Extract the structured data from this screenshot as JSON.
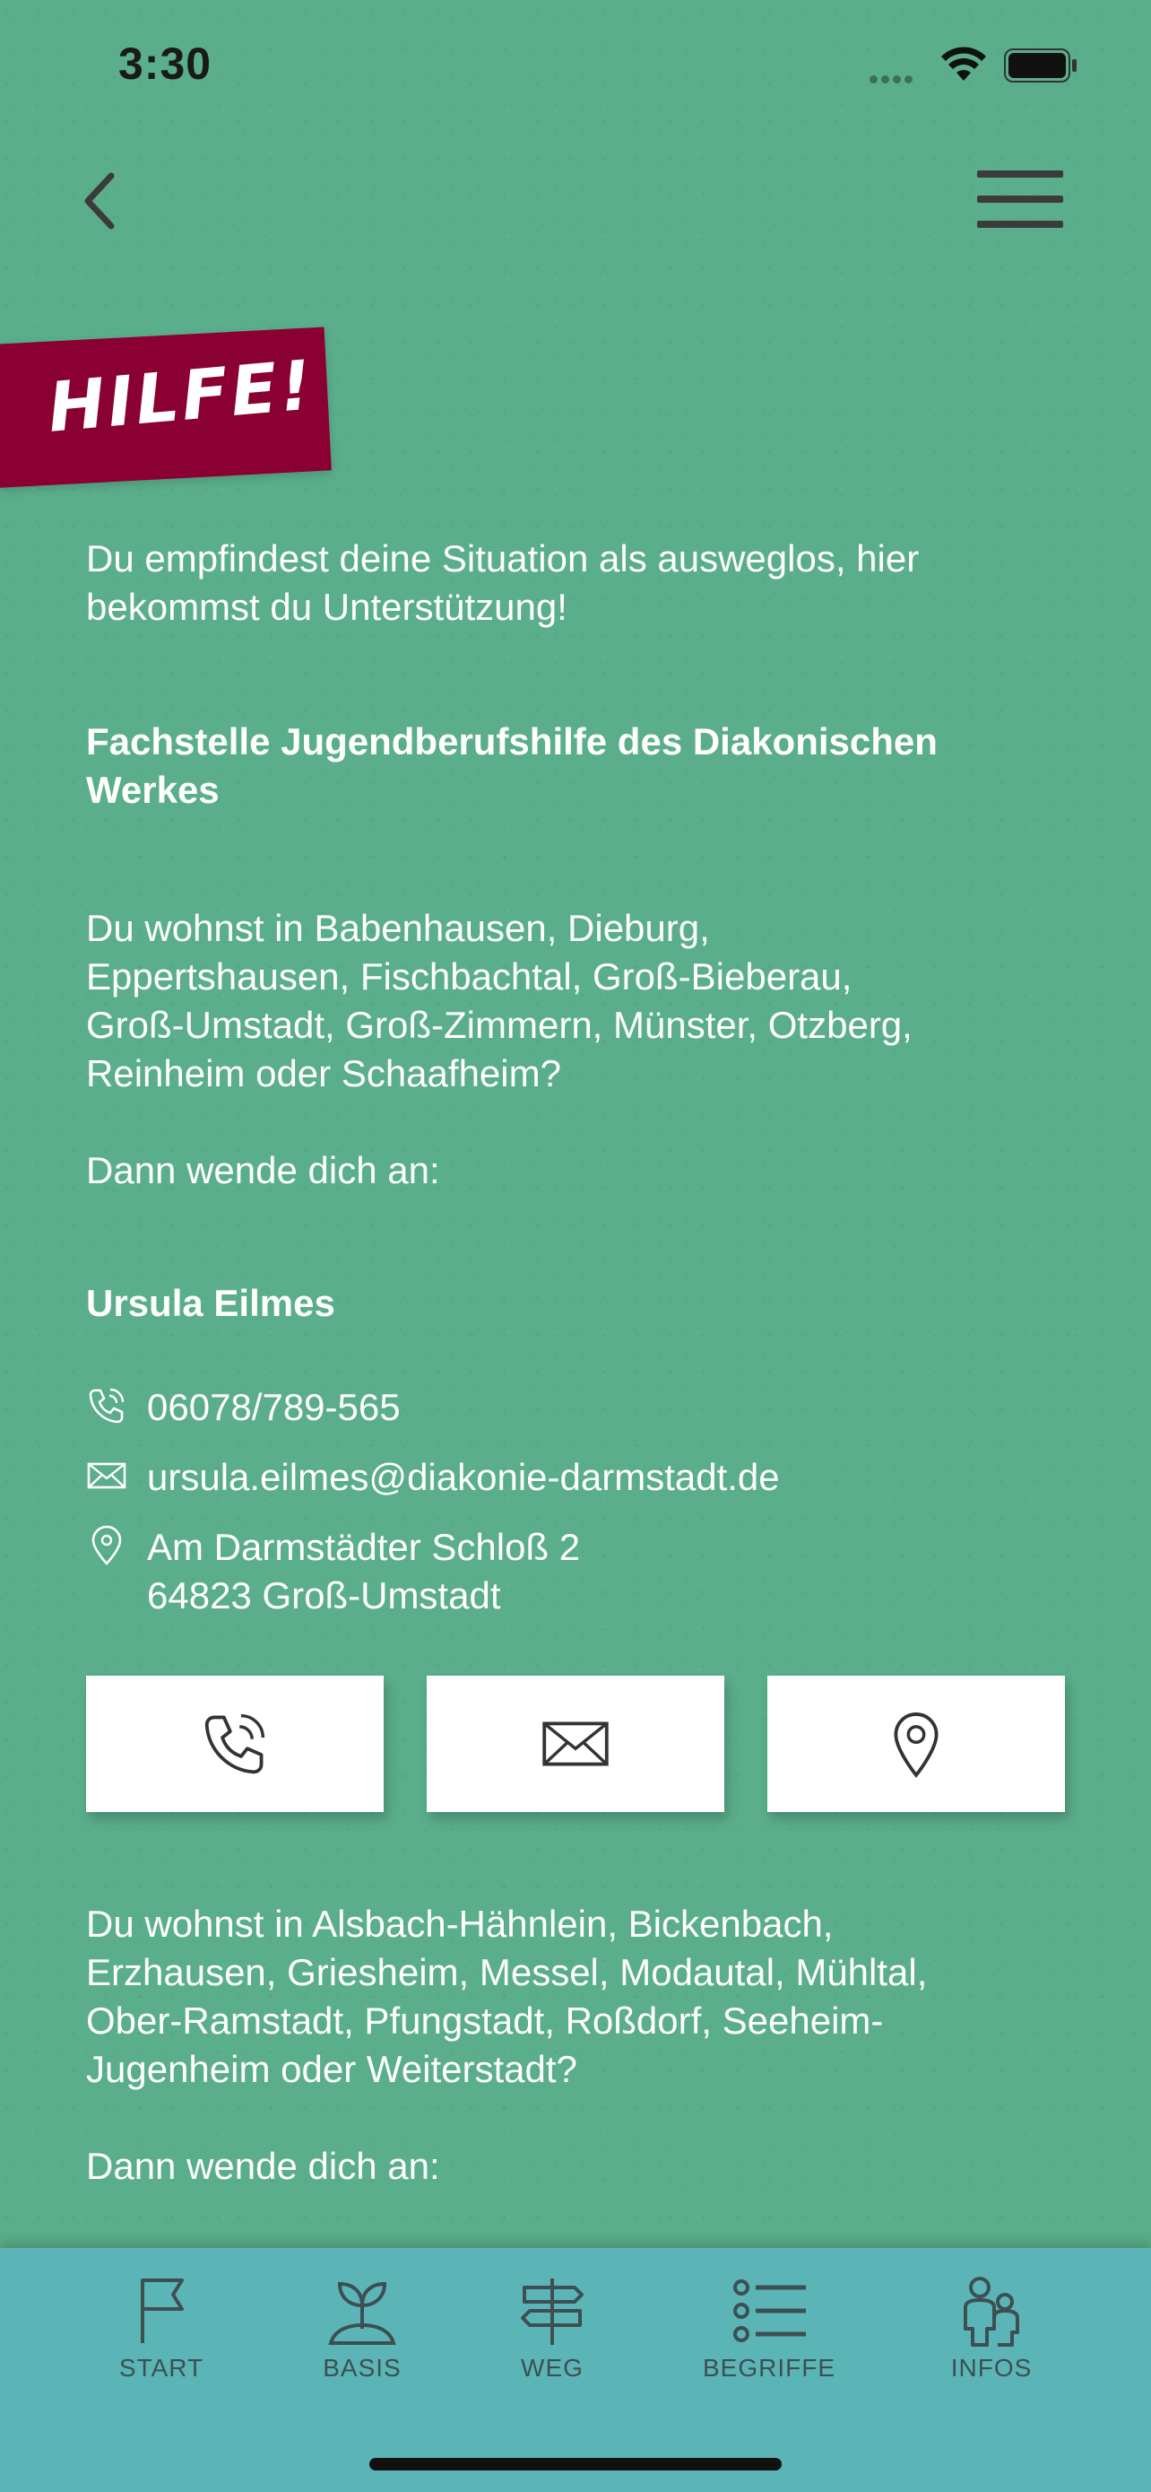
{
  "status_bar": {
    "time": "3:30"
  },
  "header": {
    "banner_title": "HILFE!"
  },
  "intro": "Du empfindest deine Situation als ausweglos, hier bekommst du Unterstützung!",
  "organization": {
    "title_line1": "Fachstelle Jugendberufshilfe des Diakonischen",
    "title_line2": "Werkes"
  },
  "section1": {
    "lines": [
      "Du wohnst in Babenhausen, Dieburg,",
      "Eppertshausen, Fischbachtal, Groß-Bieberau,",
      "Groß-Umstadt, Groß-Zimmern, Münster, Otzberg,",
      "Reinheim oder Schaafheim?"
    ],
    "contact_prompt": "Dann wende dich an:",
    "contact_name": "Ursula Eilmes",
    "phone": "06078/789-565",
    "email": "ursula.eilmes@diakonie-darmstadt.de",
    "address_line1": "Am Darmstädter Schloß 2",
    "address_line2": "64823 Groß-Umstadt"
  },
  "section2": {
    "lines": [
      "Du wohnst in Alsbach-Hähnlein, Bickenbach,",
      "Erzhausen, Griesheim, Messel, Modautal, Mühltal,",
      "Ober-Ramstadt, Pfungstadt, Roßdorf, Seeheim-",
      "Jugenheim oder Weiterstadt?"
    ],
    "contact_prompt": "Dann wende dich an:"
  },
  "tabs": [
    {
      "label": "START",
      "icon": "flag-icon"
    },
    {
      "label": "BASIS",
      "icon": "sprout-icon"
    },
    {
      "label": "WEG",
      "icon": "signpost-icon"
    },
    {
      "label": "BEGRIFFE",
      "icon": "list-icon"
    },
    {
      "label": "INFOS",
      "icon": "people-icon"
    }
  ],
  "colors": {
    "background": "#5aae8b",
    "banner": "#8b0033",
    "tab_bar": "#5bb5b7",
    "text": "#ffffff"
  }
}
